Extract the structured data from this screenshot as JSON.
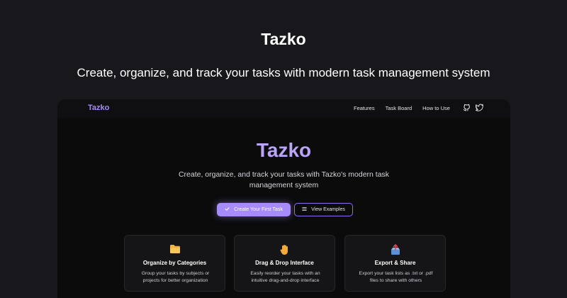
{
  "hero": {
    "title": "Tazko",
    "subtitle": "Create, organize, and track your tasks with modern task management system"
  },
  "nav": {
    "logo": "Tazko",
    "links": [
      "Features",
      "Task Board",
      "How to Use"
    ],
    "icons": [
      "github-icon",
      "twitter-icon"
    ]
  },
  "main": {
    "title": "Tazko",
    "subtitle": "Create, organize, and track your tasks with Tazko's modern task management system",
    "primary_button": "Create Your First Task",
    "secondary_button": "View Examples"
  },
  "features": [
    {
      "icon": "folder-icon",
      "title": "Organize by Categories",
      "description": "Group your tasks by subjects or projects for better organization"
    },
    {
      "icon": "hand-icon",
      "title": "Drag & Drop Interface",
      "description": "Easily reorder your tasks with an intuitive drag-and-drop interface"
    },
    {
      "icon": "outbox-icon",
      "title": "Export & Share",
      "description": "Export your task lists as .txt or .pdf files to share with others"
    }
  ],
  "colors": {
    "page_background": "#18171c",
    "frame_background": "#0b0b0c",
    "accent": "#a78bfa",
    "card_background": "#151517"
  }
}
